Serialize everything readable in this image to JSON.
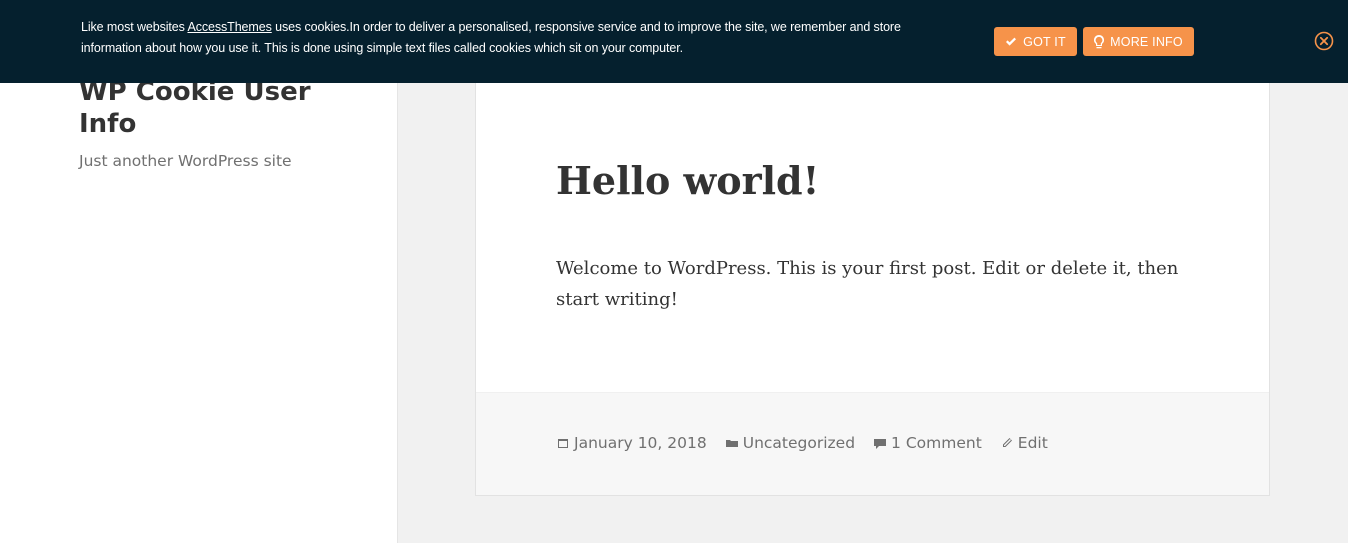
{
  "site": {
    "title": "WP Cookie User Info",
    "description": "Just another WordPress site"
  },
  "post": {
    "title": "Hello world!",
    "content": "Welcome to WordPress. This is your first post. Edit or delete it, then start writing!",
    "meta": {
      "date": "January 10, 2018",
      "category": "Uncategorized",
      "comments": "1 Comment",
      "edit": "Edit"
    }
  },
  "cookie_bar": {
    "text_before": "Like most websites ",
    "link_text": "AccessThemes",
    "text_after": " uses cookies.In order to deliver a personalised, responsive service and to improve the site, we remember and store information about how you use it. This is done using simple text files called cookies which sit on your computer.",
    "got_it_label": "GOT IT",
    "more_info_label": "MORE INFO",
    "background_color": "#05202e",
    "button_color": "#f6934a"
  },
  "icons": [
    "check-icon",
    "lightbulb-icon",
    "close-icon",
    "calendar-icon",
    "folder-icon",
    "comment-icon",
    "pencil-icon"
  ]
}
